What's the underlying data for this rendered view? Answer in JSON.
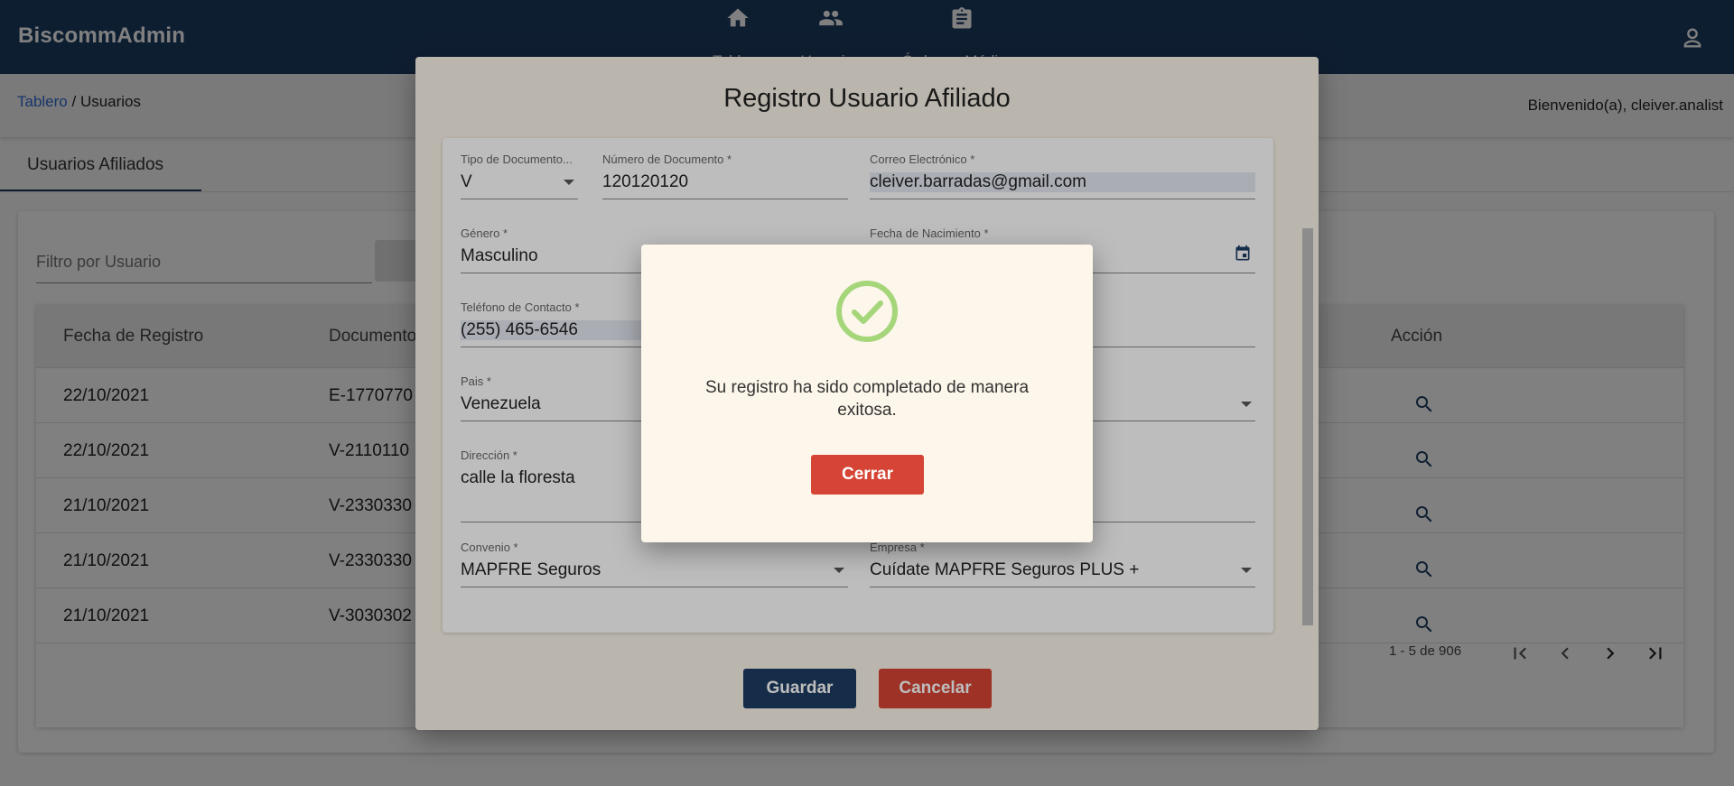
{
  "header": {
    "brand": "BiscommAdmin",
    "nav": [
      {
        "label": "Tablero",
        "icon": "home-icon"
      },
      {
        "label": "Usuarios",
        "icon": "people-icon"
      },
      {
        "label": "Órdenes Médicas",
        "icon": "clipboard-icon"
      }
    ]
  },
  "breadcrumb": {
    "link": "Tablero",
    "separator": " / ",
    "current": "Usuarios"
  },
  "welcome": "Bienvenido(a), cleiver.analist",
  "tab": "Usuarios Afiliados",
  "filter": {
    "placeholder": "Filtro por Usuario"
  },
  "table": {
    "headers": [
      "Fecha de Registro",
      "Documento",
      "Acción"
    ],
    "rows": [
      {
        "fecha": "22/10/2021",
        "documento": "E-1770770"
      },
      {
        "fecha": "22/10/2021",
        "documento": "V-2110110"
      },
      {
        "fecha": "21/10/2021",
        "documento": "V-2330330"
      },
      {
        "fecha": "21/10/2021",
        "documento": "V-2330330"
      },
      {
        "fecha": "21/10/2021",
        "documento": "V-3030302"
      }
    ],
    "pager": {
      "range": "1 - 5 de 906"
    }
  },
  "form_modal": {
    "title": "Registro Usuario Afiliado",
    "fields": {
      "tipo_documento": {
        "label": "Tipo de Documento...",
        "value": "V"
      },
      "numero_documento": {
        "label": "Número de Documento *",
        "value": "120120120"
      },
      "correo": {
        "label": "Correo Electrónico *",
        "value": "cleiver.barradas@gmail.com"
      },
      "genero": {
        "label": "Género *",
        "value": "Masculino"
      },
      "fecha_nacimiento": {
        "label": "Fecha de Nacimiento *",
        "value": ""
      },
      "telefono": {
        "label": "Teléfono de Contacto *",
        "value": "(255) 465-6546"
      },
      "pais": {
        "label": "Pais *",
        "value": "Venezuela"
      },
      "direccion": {
        "label": "Dirección *",
        "value": "calle la floresta"
      },
      "convenio": {
        "label": "Convenio *",
        "value": "MAPFRE Seguros"
      },
      "empresa": {
        "label": "Empresa *",
        "value": "Cuídate MAPFRE Seguros PLUS +"
      }
    },
    "save_label": "Guardar",
    "cancel_label": "Cancelar"
  },
  "dialog": {
    "icon": "check-circle-icon",
    "message": "Su registro ha sido completado de manera exitosa.",
    "close_label": "Cerrar"
  },
  "colors": {
    "primary": "#1e3d63",
    "danger": "#d54434",
    "success": "#8bc34a",
    "link": "#2f6bd4"
  }
}
